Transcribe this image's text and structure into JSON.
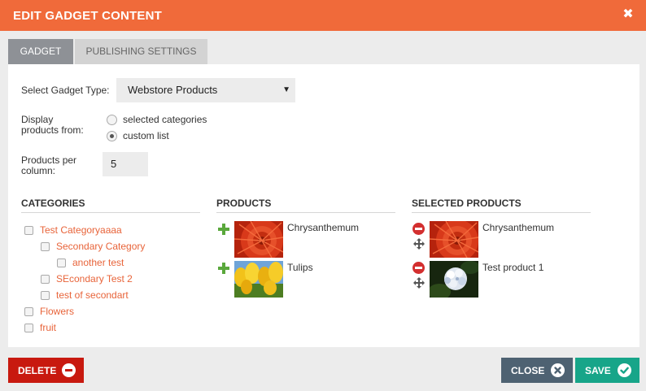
{
  "dialog": {
    "title": "EDIT GADGET CONTENT",
    "close_glyph": "✖"
  },
  "tabs": [
    {
      "label": "GADGET",
      "active": true
    },
    {
      "label": "PUBLISHING SETTINGS",
      "active": false
    }
  ],
  "form": {
    "gadget_type_label": "Select Gadget Type:",
    "gadget_type_value": "Webstore Products",
    "display_from_label_1": "Display",
    "display_from_label_2": "products from:",
    "display_options": [
      {
        "label": "selected categories",
        "selected": false
      },
      {
        "label": "custom list",
        "selected": true
      }
    ],
    "per_column_label_1": "Products per",
    "per_column_label_2": "column:",
    "per_column_value": "5"
  },
  "categories": {
    "heading": "CATEGORIES",
    "items": [
      {
        "label": "Test Categoryaaaa",
        "level": 0,
        "checked": false
      },
      {
        "label": "Secondary Category",
        "level": 1,
        "checked": false
      },
      {
        "label": "another test",
        "level": 2,
        "checked": false
      },
      {
        "label": "SEcondary Test 2",
        "level": 1,
        "checked": false
      },
      {
        "label": "test of secondart",
        "level": 1,
        "checked": false
      },
      {
        "label": "Flowers",
        "level": 0,
        "checked": false
      },
      {
        "label": "fruit",
        "level": 0,
        "checked": false
      }
    ]
  },
  "products": {
    "heading": "PRODUCTS",
    "items": [
      {
        "name": "Chrysanthemum",
        "thumb": "red-chrysanthemum"
      },
      {
        "name": "Tulips",
        "thumb": "yellow-tulips"
      }
    ]
  },
  "selected_products": {
    "heading": "SELECTED PRODUCTS",
    "items": [
      {
        "name": "Chrysanthemum",
        "thumb": "red-chrysanthemum"
      },
      {
        "name": "Test product 1",
        "thumb": "white-hydrangea"
      }
    ]
  },
  "buttons": {
    "delete": "DELETE",
    "close": "CLOSE",
    "save": "SAVE"
  },
  "colors": {
    "titlebar": "#f06a3a",
    "link": "#e8643a",
    "add_green": "#5aa83c",
    "remove_red": "#d32f2f",
    "delete_bg": "#c8190f",
    "close_bg": "#4e6272",
    "save_bg": "#17a589"
  }
}
